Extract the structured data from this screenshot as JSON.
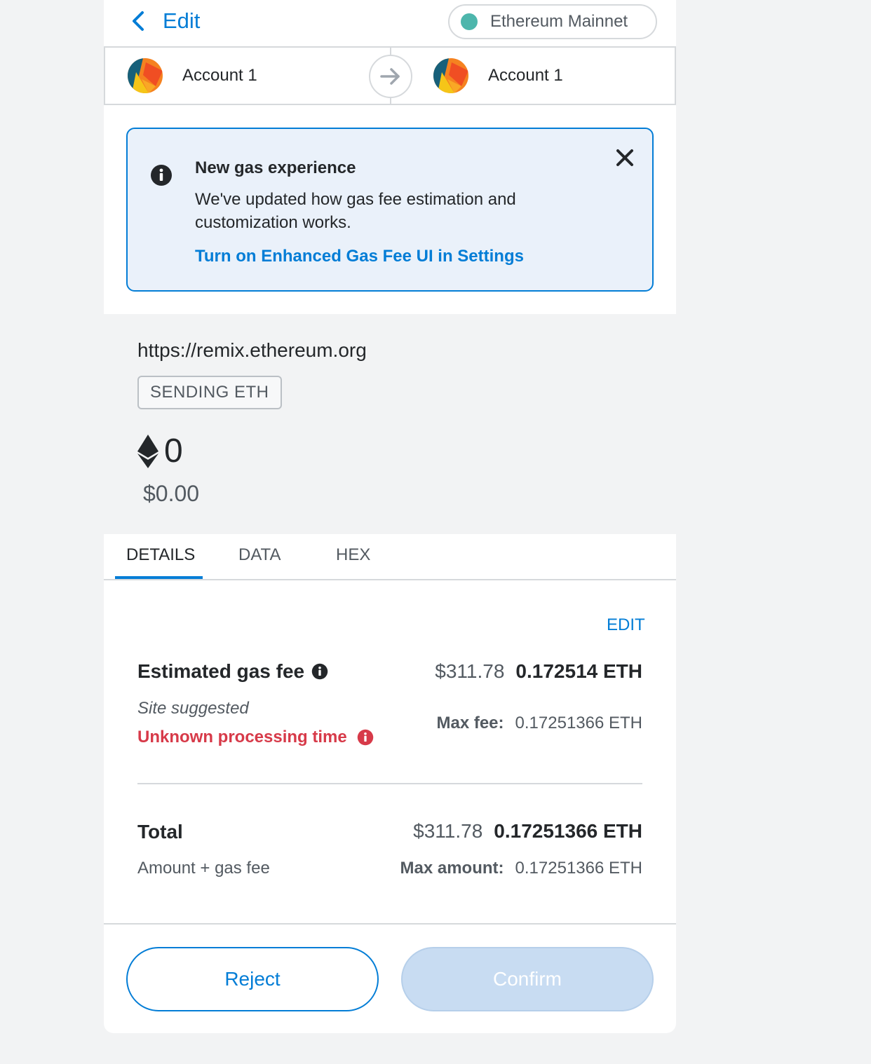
{
  "header": {
    "back_label": "Edit",
    "network_name": "Ethereum Mainnet",
    "network_color": "#4db6ac"
  },
  "accounts": {
    "from_name": "Account 1",
    "to_name": "Account 1"
  },
  "banner": {
    "title": "New gas experience",
    "description": "We've updated how gas fee estimation and customization works.",
    "link": "Turn on Enhanced Gas Fee UI in Settings"
  },
  "summary": {
    "origin": "https://remix.ethereum.org",
    "type": "SENDING ETH",
    "amount": "0",
    "fiat": "$0.00"
  },
  "tabs": [
    "DETAILS",
    "DATA",
    "HEX"
  ],
  "details": {
    "edit_label": "EDIT",
    "gas_label": "Estimated gas fee",
    "gas_fiat": "$311.78",
    "gas_eth": "0.172514 ETH",
    "site_suggested": "Site suggested",
    "processing_time": "Unknown processing time",
    "max_fee_label": "Max fee:",
    "max_fee_value": "0.17251366 ETH",
    "total_label": "Total",
    "total_fiat": "$311.78",
    "total_eth": "0.17251366 ETH",
    "total_sub": "Amount + gas fee",
    "max_amount_label": "Max amount:",
    "max_amount_value": "0.17251366 ETH"
  },
  "buttons": {
    "reject": "Reject",
    "confirm": "Confirm"
  },
  "colors": {
    "accent": "#037dd6",
    "error": "#d73a49",
    "banner_bg": "#eaf1fa"
  }
}
